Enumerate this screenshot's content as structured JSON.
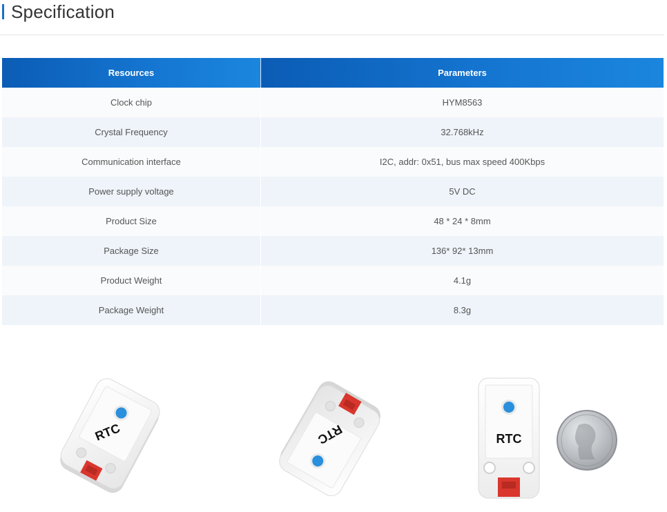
{
  "page": {
    "heading": "Specification"
  },
  "table": {
    "headers": [
      "Resources",
      "Parameters"
    ],
    "rows": [
      [
        "Clock chip",
        "HYM8563"
      ],
      [
        "Crystal Frequency",
        "32.768kHz"
      ],
      [
        "Communication interface",
        "I2C, addr: 0x51, bus max speed 400Kbps"
      ],
      [
        "Power supply voltage",
        "5V DC"
      ],
      [
        "Product Size",
        "48 * 24 * 8mm"
      ],
      [
        "Package Size",
        "136* 92* 13mm"
      ],
      [
        "Product Weight",
        "4.1g"
      ],
      [
        "Package Weight",
        "8.3g"
      ]
    ]
  },
  "photos": {
    "module_label": "RTC",
    "colors": {
      "case": "#f4f4f4",
      "connector": "#d9362d",
      "button": "#2a8fdc",
      "coin": "#b9bcc0"
    }
  }
}
